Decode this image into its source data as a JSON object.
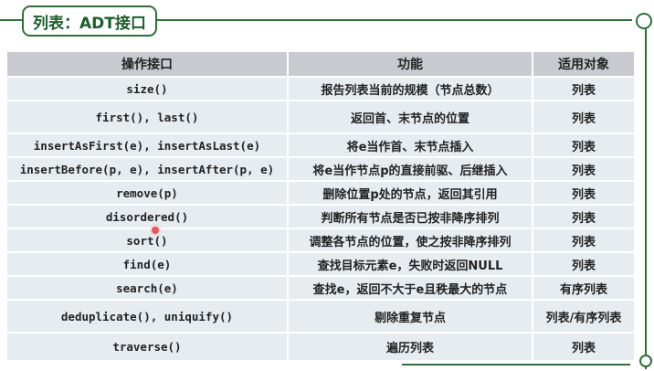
{
  "slide": {
    "title": "列表：ADT接口"
  },
  "table": {
    "headers": {
      "api": "操作接口",
      "function": "功能",
      "applies_to": "适用对象"
    },
    "rows": [
      {
        "api": "size()",
        "function": "报告列表当前的规模（节点总数）",
        "applies_to": "列表"
      },
      {
        "api": "first(), last()",
        "function": "返回首、末节点的位置",
        "applies_to": "列表"
      },
      {
        "api": "insertAsFirst(e), insertAsLast(e)",
        "function": "将e当作首、末节点插入",
        "applies_to": "列表"
      },
      {
        "api": "insertBefore(p, e), insertAfter(p, e)",
        "function": "将e当作节点p的直接前驱、后继插入",
        "applies_to": "列表"
      },
      {
        "api": "remove(p)",
        "function": "删除位置p处的节点，返回其引用",
        "applies_to": "列表"
      },
      {
        "api": "disordered()",
        "function": "判断所有节点是否已按非降序排列",
        "applies_to": "列表"
      },
      {
        "api": "sort()",
        "function": "调整各节点的位置，使之按非降序排列",
        "applies_to": "列表"
      },
      {
        "api": "find(e)",
        "function": "查找目标元素e，失败时返回NULL",
        "applies_to": "列表"
      },
      {
        "api": "search(e)",
        "function": "查找e，返回不大于e且秩最大的节点",
        "applies_to": "有序列表"
      },
      {
        "api": "deduplicate(), uniquify()",
        "function": "剔除重复节点",
        "applies_to": "列表/有序列表"
      },
      {
        "api": "traverse()",
        "function": "遍历列表",
        "applies_to": "列表"
      }
    ]
  },
  "colors": {
    "accent_green": "#2f6f3a",
    "header_bg": "#c7cbcf",
    "row_bg": "#e7ecf0",
    "pointer_red": "#e35a5a"
  }
}
